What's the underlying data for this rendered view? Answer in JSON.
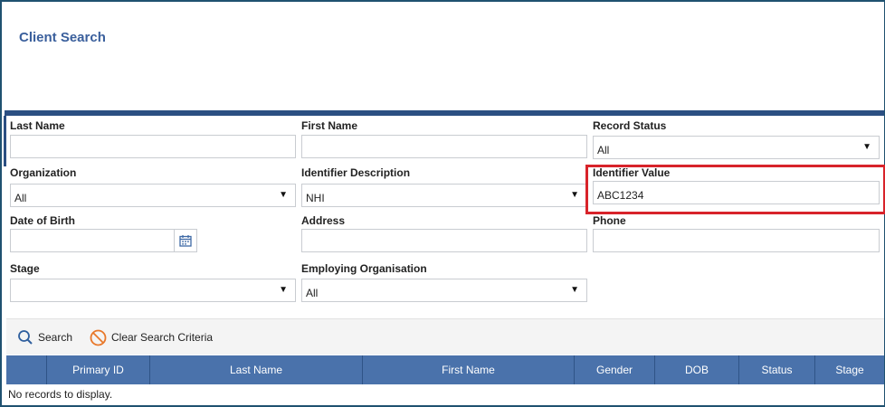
{
  "page": {
    "title": "Client Search"
  },
  "form": {
    "last_name": {
      "label": "Last Name",
      "value": ""
    },
    "first_name": {
      "label": "First Name",
      "value": ""
    },
    "record_status": {
      "label": "Record Status",
      "value": "All"
    },
    "organization": {
      "label": "Organization",
      "value": "All"
    },
    "identifier_description": {
      "label": "Identifier Description",
      "value": "NHI"
    },
    "identifier_value": {
      "label": "Identifier Value",
      "value": "ABC1234"
    },
    "date_of_birth": {
      "label": "Date of Birth",
      "value": ""
    },
    "address": {
      "label": "Address",
      "value": ""
    },
    "phone": {
      "label": "Phone",
      "value": ""
    },
    "stage": {
      "label": "Stage",
      "value": ""
    },
    "employing_organisation": {
      "label": "Employing Organisation",
      "value": "All"
    }
  },
  "toolbar": {
    "search_label": "Search",
    "clear_label": "Clear Search Criteria"
  },
  "grid": {
    "columns": [
      "",
      "Primary ID",
      "Last Name",
      "First Name",
      "Gender",
      "DOB",
      "Status",
      "Stage"
    ],
    "empty_message": "No records to display."
  },
  "icons": {
    "caret": "▼",
    "search": "magnifier-icon",
    "clear": "prohibit-icon",
    "calendar": "calendar-icon"
  },
  "colors": {
    "title": "#3a5f9c",
    "header_bar": "#2b4f82",
    "grid_header": "#4a72ab",
    "highlight": "#d8232a",
    "clear_icon": "#e8782a",
    "search_icon": "#2f5f9e"
  }
}
